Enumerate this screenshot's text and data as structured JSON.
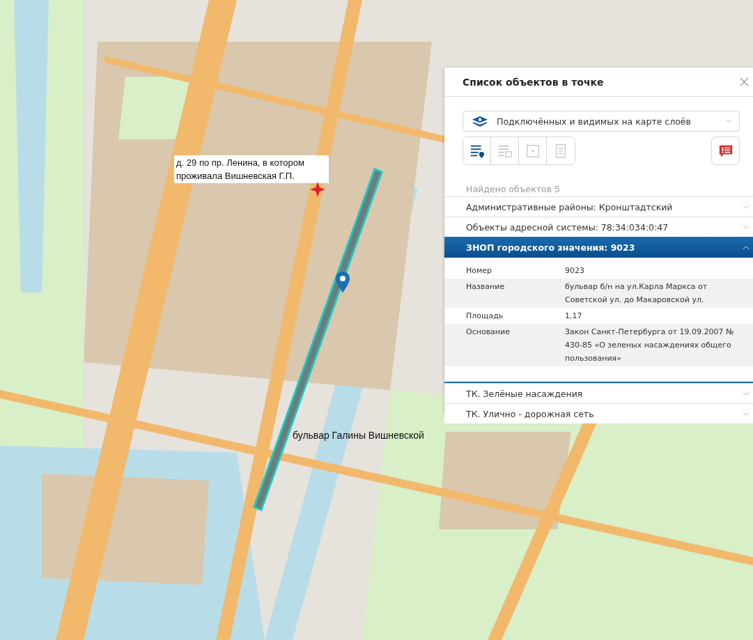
{
  "map": {
    "labels": [
      {
        "text": "д. 29 по пр. Ленина, в котором проживала Вишневская Г.П.",
        "kind": "boxed"
      },
      {
        "text": "бульвар Галины Вишневской",
        "kind": "plain"
      }
    ]
  },
  "panel": {
    "title": "Список объектов в точке",
    "layer_select": {
      "value": "Подключённых и видимых на карте слоёв"
    },
    "tools": [
      {
        "kind": "list-pin",
        "selected": true
      },
      {
        "kind": "list-frame",
        "selected": false
      },
      {
        "kind": "query-frame",
        "selected": false
      },
      {
        "kind": "document",
        "selected": false
      }
    ],
    "found": "Найдено объектов 5",
    "sections": [
      {
        "title": "Административные районы: Кронштадтский",
        "expanded": false
      },
      {
        "title": "Объекты адресной системы: 78:34:034:0:47",
        "expanded": false
      },
      {
        "title": "ЗНОП городского значения: 9023",
        "expanded": true,
        "fields": [
          {
            "label": "Номер",
            "value": "9023"
          },
          {
            "label": "Название",
            "value": "бульвар б/н на ул.Карла Маркса от Советской ул. до Макаровской ул."
          },
          {
            "label": "Площадь",
            "value": "1,17"
          },
          {
            "label": "Основание",
            "value": "Закон Санкт-Петербурга от 19.09.2007 № 430-85 «О зеленых насаждениях общего пользования»"
          }
        ]
      },
      {
        "title": "ТК. Зелёные насаждения",
        "expanded": false
      },
      {
        "title": "ТК. Улично - дорожная сеть",
        "expanded": false
      }
    ]
  }
}
